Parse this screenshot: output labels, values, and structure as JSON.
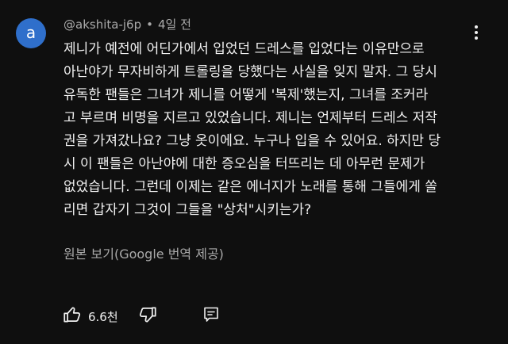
{
  "comment": {
    "avatar_letter": "a",
    "avatar_color": "#2f6fcb",
    "author": "@akshita-j6p",
    "separator": "•",
    "time_ago": "4일 전",
    "body": "제니가 예전에 어딘가에서 입었던 드레스를 입었다는 이유만으로\n아난야가 무자비하게 트롤링을 당했다는 사실을 잊지 말자. 그 당시\n유독한 팬들은 그녀가 제니를 어떻게 '복제'했는지, 그녀를 조커라\n고 부르며 비명을 지르고 있었습니다. 제니는 언제부터 드레스 저작\n권을 가져갔나요? 그냥 옷이에요. 누구나 입을 수 있어요. 하지만 당\n시 이 팬들은 아난야에 대한 증오심을 터뜨리는 데 아무런 문제가\n없었습니다. 그런데 이제는 같은 에너지가 노래를 통해 그들에게 쏠\n리면 갑자기 그것이 그들을 \"상처\"시키는가?",
    "translate_label": "원본 보기(Google 번역 제공)",
    "like_count": "6.6천"
  },
  "icons": {
    "menu": "more-vert-icon",
    "like": "thumb-up-icon",
    "dislike": "thumb-down-icon",
    "reply": "comment-reply-icon"
  },
  "colors": {
    "background": "#0f0f0f",
    "primary_text": "#f1f1f1",
    "secondary_text": "#aaaaaa"
  }
}
